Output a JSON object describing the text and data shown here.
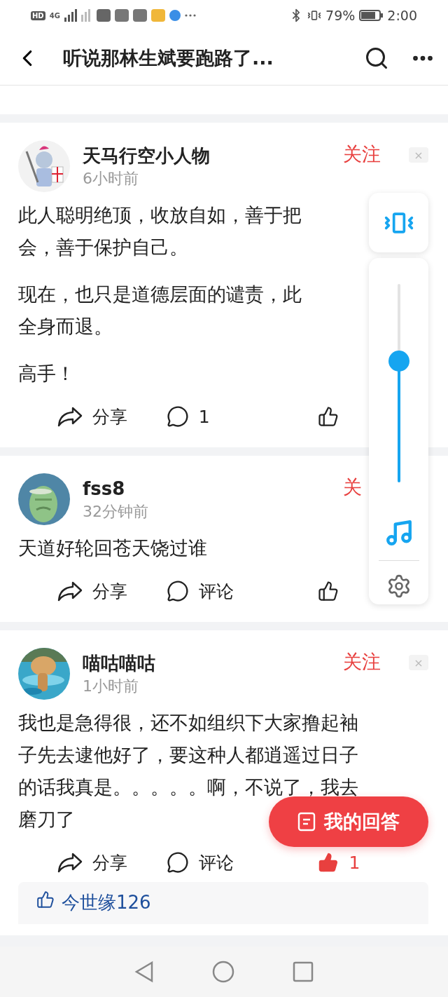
{
  "status_bar": {
    "hd_label": "HD",
    "network_label": "4G",
    "battery": "79%",
    "time": "2:00"
  },
  "header": {
    "title": "听说那林生斌要跑路了..."
  },
  "posts": [
    {
      "author": "天马行空小人物",
      "time": "6小时前",
      "follow": "关注",
      "dismiss": "×",
      "paragraphs": [
        [
          "此人聪明绝顶，收放自如，善于把",
          "会，善于保护自己。"
        ],
        [
          "现在，也只是道德层面的谴责，此",
          "全身而退。"
        ],
        [
          "高手！"
        ]
      ],
      "actions": [
        {
          "kind": "share",
          "label": "分享"
        },
        {
          "kind": "comment",
          "label": "1"
        },
        {
          "kind": "like",
          "liked": false
        }
      ]
    },
    {
      "author": "fss8",
      "time": "32分钟前",
      "follow": "关",
      "paragraphs": [
        [
          "天道好轮回苍天饶过谁"
        ]
      ],
      "actions": [
        {
          "kind": "share",
          "label": "分享"
        },
        {
          "kind": "comment",
          "label": "评论"
        },
        {
          "kind": "like",
          "liked": false
        }
      ]
    },
    {
      "author": "喵咕喵咕",
      "time": "1小时前",
      "follow": "关注",
      "dismiss": "×",
      "paragraphs": [
        [
          "我也是急得很，还不如组织下大家撸起袖",
          "子先去逮他好了，要这种人都逍遥过日子",
          "的话我真是。。。。。啊，不说了，我去",
          "磨刀了"
        ]
      ],
      "actions": [
        {
          "kind": "share",
          "label": "分享"
        },
        {
          "kind": "comment",
          "label": "评论"
        },
        {
          "kind": "like",
          "liked": true,
          "label": "1"
        }
      ],
      "reply_preview": {
        "text": "今世缘126"
      }
    }
  ],
  "answer_button": {
    "label": "我的回答"
  },
  "volume_panel": {
    "level": 0.61
  }
}
